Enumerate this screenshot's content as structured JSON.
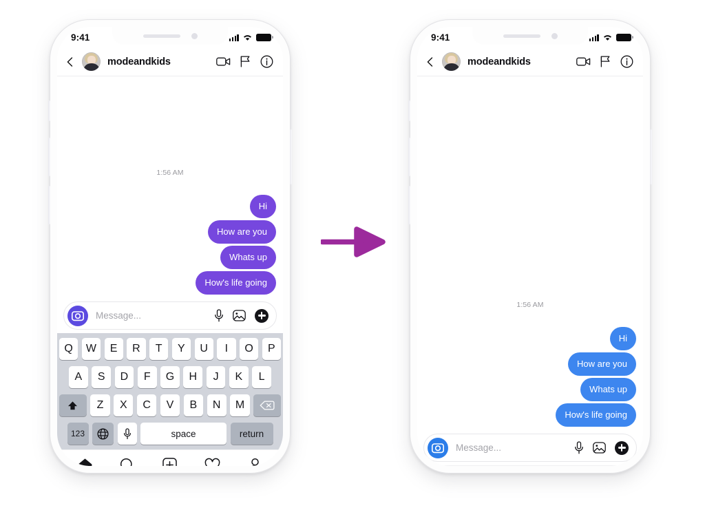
{
  "meta": {
    "scene_title": "Instagram DM chat theme comparison",
    "arrow_icon": "arrow-right-icon",
    "arrow_color": "#9c2a9c"
  },
  "phones": [
    {
      "id": "left",
      "accent": "#6b3fd4",
      "bubble_color": "#7647de",
      "camera_color": "#5b4ae0",
      "keyboard_visible": true,
      "status_bar": {
        "time": "9:41",
        "signal_icon": "cellular-signal-icon",
        "wifi_icon": "wifi-icon",
        "battery_icon": "battery-full-icon"
      },
      "chat_header": {
        "back_icon": "chevron-left-icon",
        "avatar_icon": "avatar",
        "username": "modeandkids",
        "actions": [
          {
            "icon": "video-camera-icon",
            "name": "video-call-button"
          },
          {
            "icon": "flag-icon",
            "name": "flag-button"
          },
          {
            "icon": "info-circle-icon",
            "name": "info-button"
          }
        ]
      },
      "conversation": {
        "timestamp": "1:56 AM",
        "messages": [
          {
            "text": "Hi",
            "side": "outgoing"
          },
          {
            "text": "How are you",
            "side": "outgoing"
          },
          {
            "text": "Whats up",
            "side": "outgoing"
          },
          {
            "text": "How's life going",
            "side": "outgoing"
          }
        ]
      },
      "input_bar": {
        "camera_icon": "camera-icon",
        "placeholder": "Message...",
        "actions": [
          {
            "icon": "microphone-icon",
            "name": "voice-message-button"
          },
          {
            "icon": "photo-icon",
            "name": "gallery-button"
          },
          {
            "icon": "plus-icon",
            "name": "more-button"
          }
        ]
      },
      "tab_bar": {
        "items": [
          {
            "icon": "home-icon",
            "name": "tab-home",
            "active": true,
            "badge": true
          },
          {
            "icon": "search-icon",
            "name": "tab-search",
            "active": false,
            "badge": false
          },
          {
            "icon": "plus-square-icon",
            "name": "tab-create",
            "active": false,
            "badge": false
          },
          {
            "icon": "heart-icon",
            "name": "tab-activity",
            "active": false,
            "badge": false
          },
          {
            "icon": "person-icon",
            "name": "tab-profile",
            "active": false,
            "badge": false
          }
        ]
      }
    },
    {
      "id": "right",
      "accent": "#2f7ae5",
      "bubble_color": "#3d86ef",
      "camera_color": "#2b7de9",
      "keyboard_visible": false,
      "status_bar": {
        "time": "9:41",
        "signal_icon": "cellular-signal-icon",
        "wifi_icon": "wifi-icon",
        "battery_icon": "battery-full-icon"
      },
      "chat_header": {
        "back_icon": "chevron-left-icon",
        "avatar_icon": "avatar",
        "username": "modeandkids",
        "actions": [
          {
            "icon": "video-camera-icon",
            "name": "video-call-button"
          },
          {
            "icon": "flag-icon",
            "name": "flag-button"
          },
          {
            "icon": "info-circle-icon",
            "name": "info-button"
          }
        ]
      },
      "conversation": {
        "timestamp": "1:56 AM",
        "messages": [
          {
            "text": "Hi",
            "side": "outgoing"
          },
          {
            "text": "How are you",
            "side": "outgoing"
          },
          {
            "text": "Whats up",
            "side": "outgoing"
          },
          {
            "text": "How's life going",
            "side": "outgoing"
          }
        ]
      },
      "input_bar": {
        "camera_icon": "camera-icon",
        "placeholder": "Message...",
        "actions": [
          {
            "icon": "microphone-icon",
            "name": "voice-message-button"
          },
          {
            "icon": "photo-icon",
            "name": "gallery-button"
          },
          {
            "icon": "plus-icon",
            "name": "more-button"
          }
        ]
      },
      "tab_bar": {
        "items": [
          {
            "icon": "home-icon",
            "name": "tab-home",
            "active": true,
            "badge": true
          },
          {
            "icon": "search-icon",
            "name": "tab-search",
            "active": false,
            "badge": false
          },
          {
            "icon": "plus-square-icon",
            "name": "tab-create",
            "active": false,
            "badge": false
          },
          {
            "icon": "heart-icon",
            "name": "tab-activity",
            "active": false,
            "badge": false
          },
          {
            "icon": "person-icon",
            "name": "tab-profile",
            "active": false,
            "badge": false
          }
        ]
      }
    }
  ],
  "keyboard": {
    "row1": [
      "Q",
      "W",
      "E",
      "R",
      "T",
      "Y",
      "U",
      "I",
      "O",
      "P"
    ],
    "row2": [
      "A",
      "S",
      "D",
      "F",
      "G",
      "H",
      "J",
      "K",
      "L"
    ],
    "row3": [
      "Z",
      "X",
      "C",
      "V",
      "B",
      "N",
      "M"
    ],
    "shift_icon": "shift-up-icon",
    "backspace_icon": "backspace-icon",
    "numbers_label": "123",
    "globe_icon": "globe-icon",
    "mic_icon": "microphone-icon",
    "space_label": "space",
    "return_label": "return"
  }
}
